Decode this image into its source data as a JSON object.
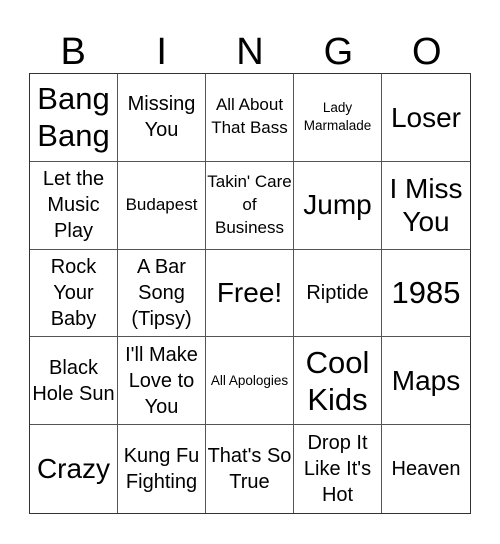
{
  "header": {
    "letters": [
      "B",
      "I",
      "N",
      "G",
      "O"
    ]
  },
  "board": {
    "rows": [
      [
        {
          "text": "Bang Bang",
          "size": "xl"
        },
        {
          "text": "Missing You",
          "size": "md"
        },
        {
          "text": "All About That Bass",
          "size": "sm"
        },
        {
          "text": "Lady Marmalade",
          "size": "xs"
        },
        {
          "text": "Loser",
          "size": "lg"
        }
      ],
      [
        {
          "text": "Let the Music Play",
          "size": "md"
        },
        {
          "text": "Budapest",
          "size": "sm"
        },
        {
          "text": "Takin' Care of Business",
          "size": "sm"
        },
        {
          "text": "Jump",
          "size": "lg"
        },
        {
          "text": "I Miss You",
          "size": "lg"
        }
      ],
      [
        {
          "text": "Rock Your Baby",
          "size": "md"
        },
        {
          "text": "A Bar Song (Tipsy)",
          "size": "md"
        },
        {
          "text": "Free!",
          "size": "lg"
        },
        {
          "text": "Riptide",
          "size": "md"
        },
        {
          "text": "1985",
          "size": "xl"
        }
      ],
      [
        {
          "text": "Black Hole Sun",
          "size": "md"
        },
        {
          "text": "I'll Make Love to You",
          "size": "md"
        },
        {
          "text": "All Apologies",
          "size": "xs"
        },
        {
          "text": "Cool Kids",
          "size": "xl"
        },
        {
          "text": "Maps",
          "size": "lg"
        }
      ],
      [
        {
          "text": "Crazy",
          "size": "lg"
        },
        {
          "text": "Kung Fu Fighting",
          "size": "md"
        },
        {
          "text": "That's So True",
          "size": "md"
        },
        {
          "text": "Drop It Like It's Hot",
          "size": "md"
        },
        {
          "text": "Heaven",
          "size": "md"
        }
      ]
    ]
  }
}
